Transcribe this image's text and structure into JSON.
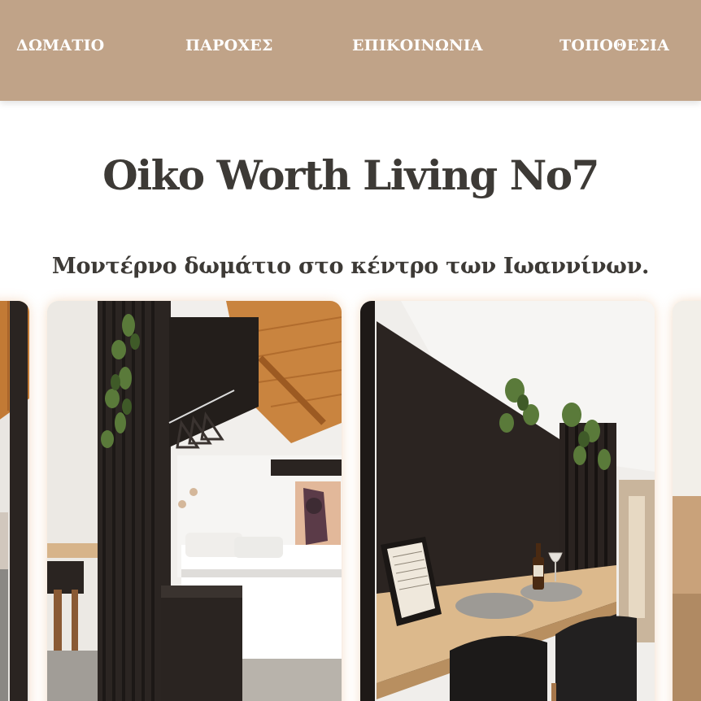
{
  "nav": {
    "items": [
      {
        "label": "ΔΩΜΑΤΙΟ"
      },
      {
        "label": "ΠΑΡΟΧΕΣ"
      },
      {
        "label": "ΕΠΙΚΟΙΝΩΝΙΑ"
      },
      {
        "label": "ΤΟΠΟΘΕΣΙΑ"
      }
    ],
    "background": "#c0a388",
    "text_color": "#ffffff"
  },
  "hero": {
    "title": "Oiko Worth Living No7",
    "subtitle": "Μοντέρνο δωμάτιο στο κέντρο των Ιωαννίνων."
  },
  "gallery": {
    "images": [
      {
        "name": "photo-room-partial-left"
      },
      {
        "name": "photo-bedroom-partition"
      },
      {
        "name": "photo-desk-wine"
      },
      {
        "name": "photo-partial-right"
      }
    ]
  },
  "colors": {
    "text": "#3d3a36",
    "accent": "#c0a388",
    "wood": "#c9843f"
  }
}
